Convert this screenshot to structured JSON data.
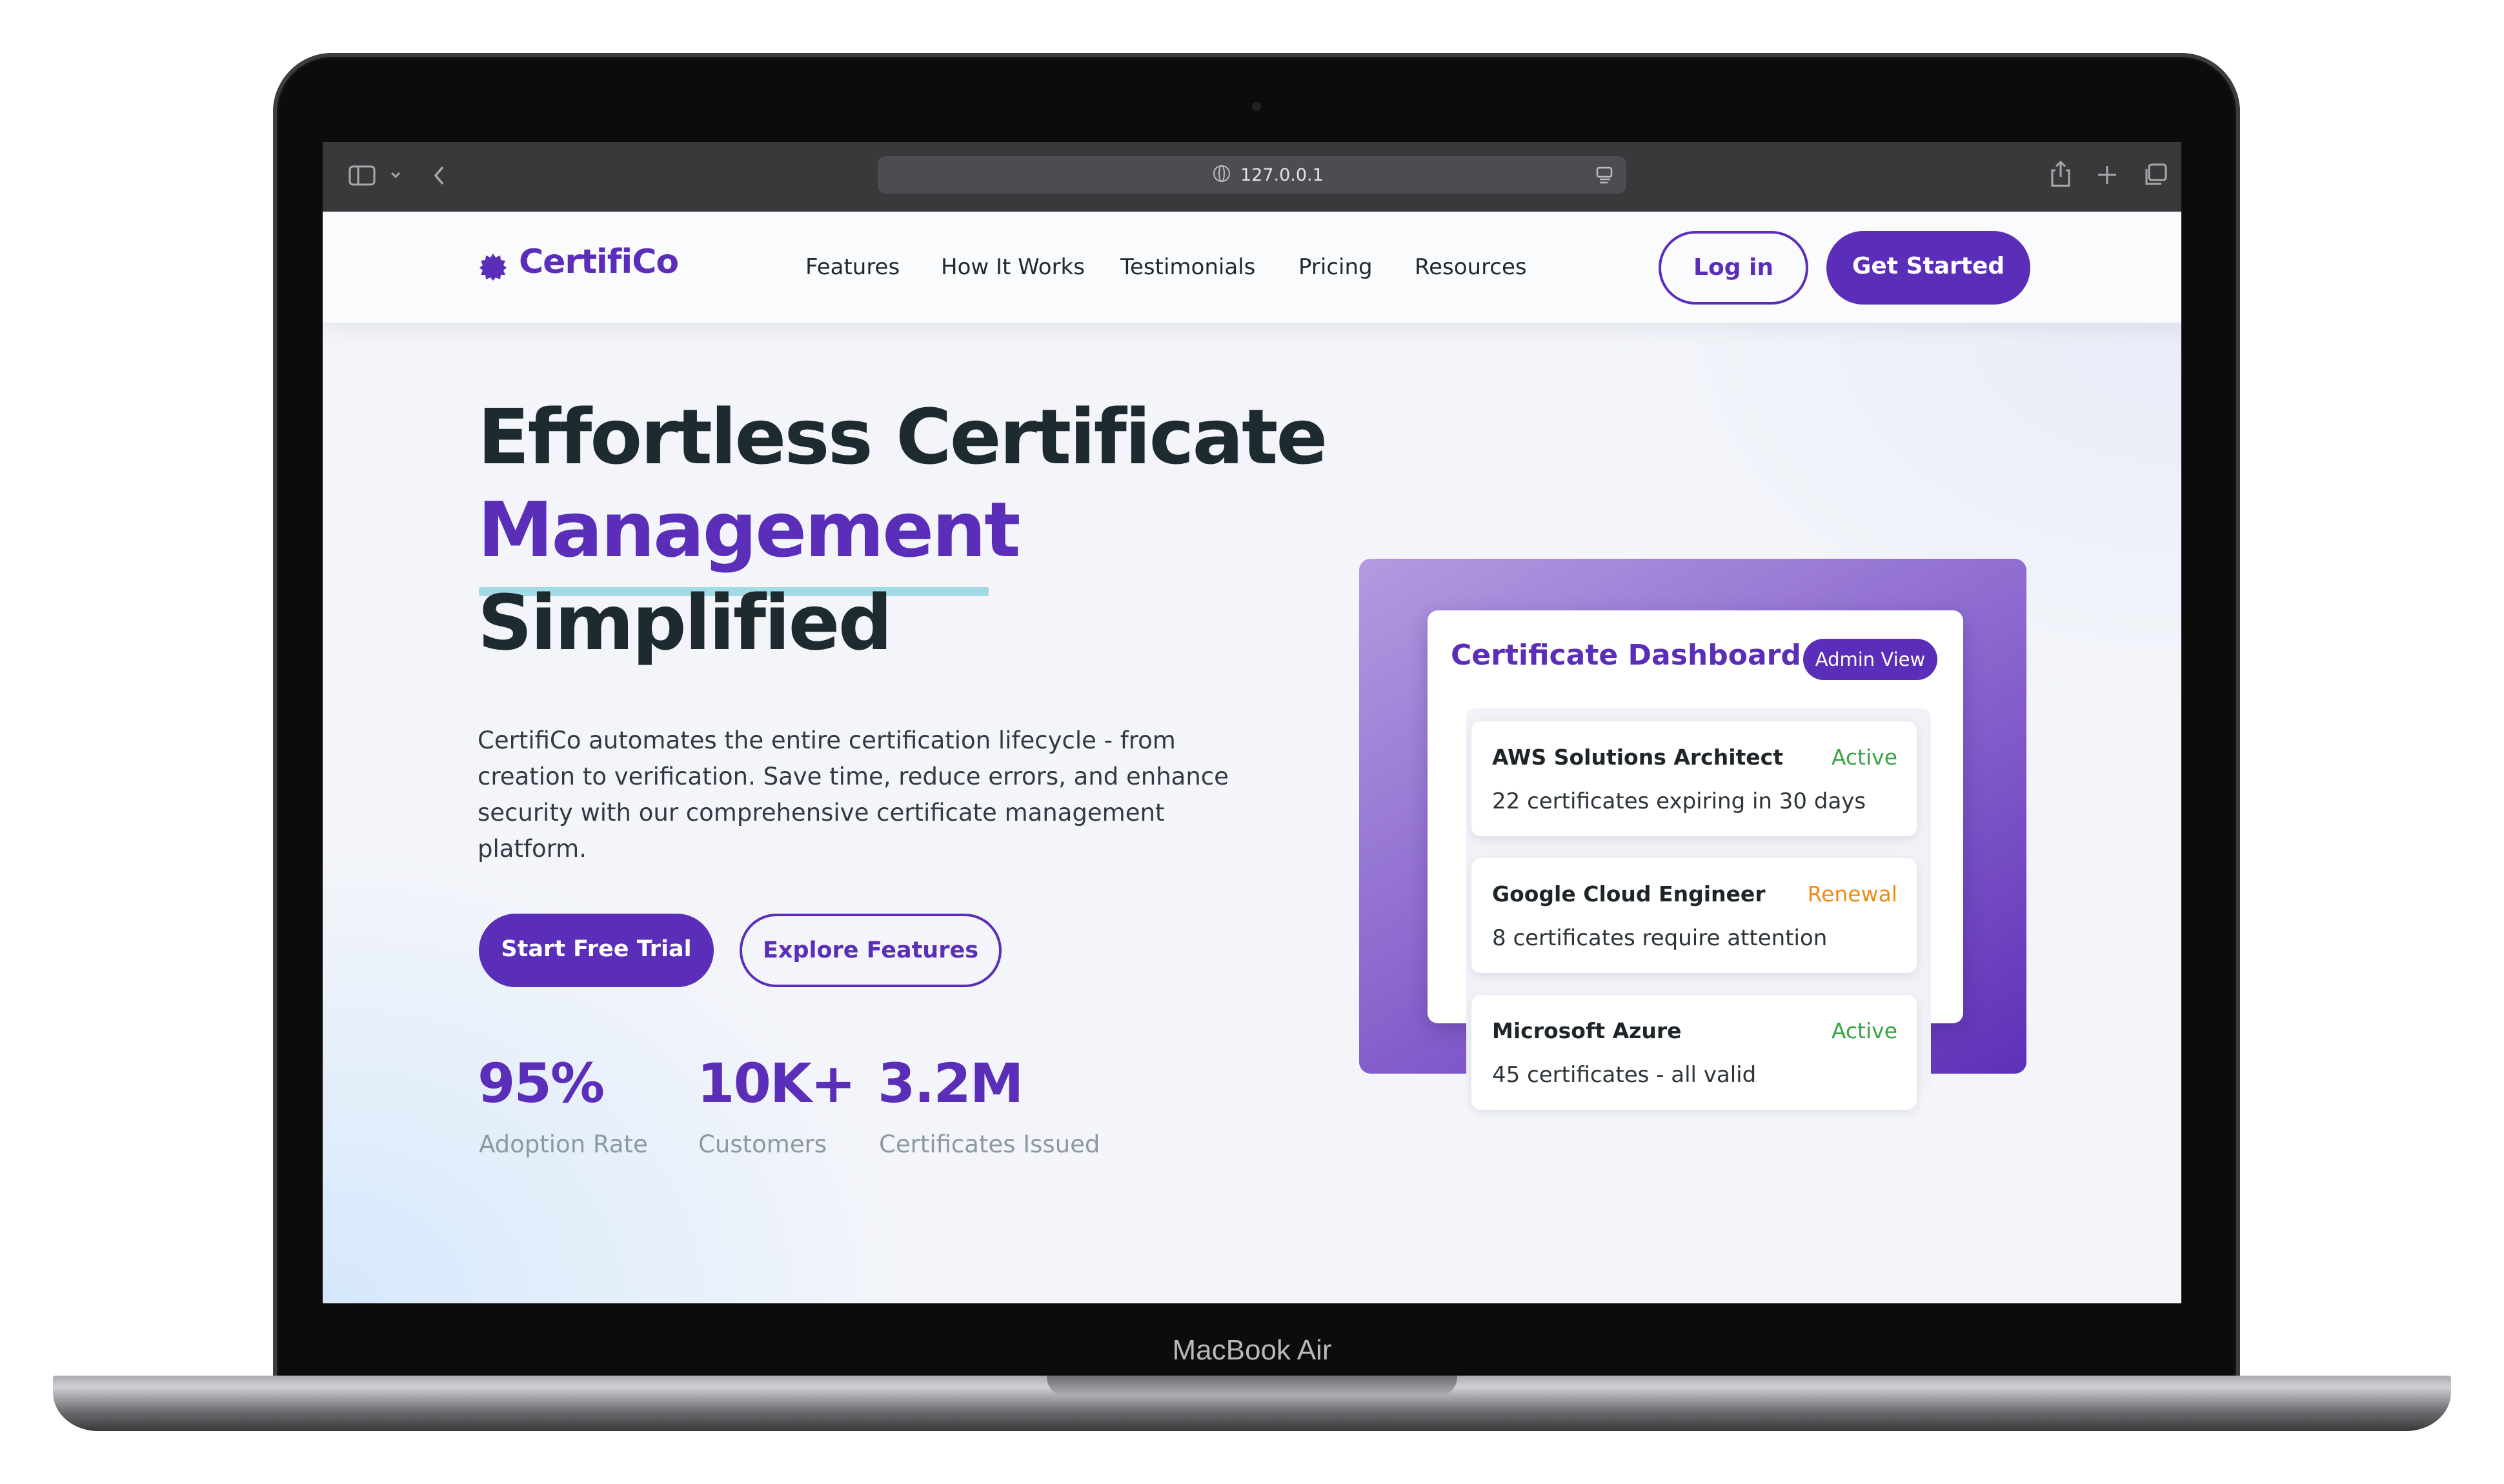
{
  "device": {
    "label": "MacBook Air"
  },
  "browser": {
    "url": "127.0.0.1"
  },
  "nav": {
    "brand": "CertifiCo",
    "links": [
      "Features",
      "How It Works",
      "Testimonials",
      "Pricing",
      "Resources"
    ],
    "login_label": "Log in",
    "cta_label": "Get Started"
  },
  "hero": {
    "title_line1": "Effortless Certificate",
    "title_line2": "Management",
    "title_line3": "Simplified",
    "lead": "CertifiCo automates the entire certification lifecycle - from creation to verification. Save time, reduce errors, and enhance security with our comprehensive certificate management platform.",
    "primary_cta": "Start Free Trial",
    "secondary_cta": "Explore Features",
    "stats": [
      {
        "value": "95%",
        "label": "Adoption Rate"
      },
      {
        "value": "10K+",
        "label": "Customers"
      },
      {
        "value": "3.2M",
        "label": "Certificates Issued"
      }
    ]
  },
  "dashboard": {
    "title": "Certificate Dashboard",
    "badge": "Admin View",
    "certs": [
      {
        "name": "AWS Solutions Architect",
        "status": "Active",
        "status_color": "#3aa345",
        "desc": "22 certificates expiring in 30 days"
      },
      {
        "name": "Google Cloud Engineer",
        "status": "Renewal",
        "status_color": "#f08a12",
        "desc": "8 certificates require attention"
      },
      {
        "name": "Microsoft Azure",
        "status": "Active",
        "status_color": "#3aa345",
        "desc": "45 certificates - all valid"
      }
    ]
  },
  "colors": {
    "brand": "#5a2eb8",
    "accent_underline": "#a2dbe6"
  }
}
